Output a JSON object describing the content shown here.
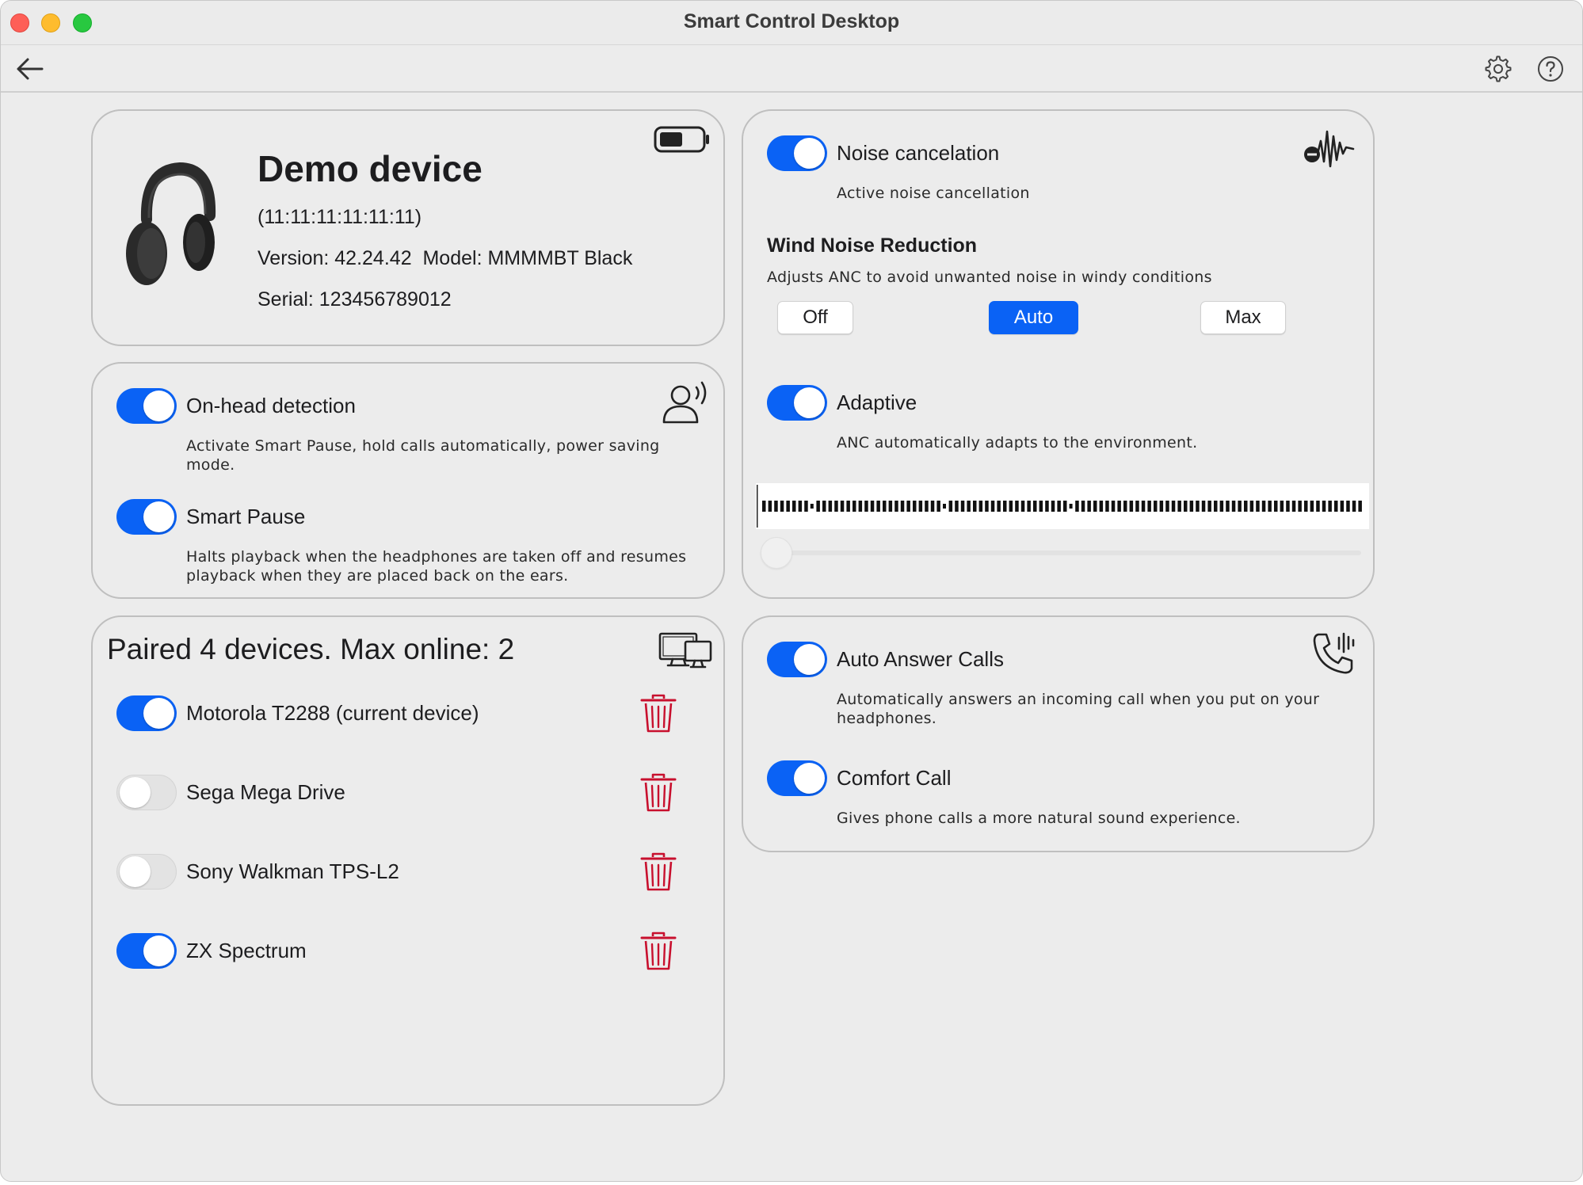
{
  "window": {
    "title": "Smart Control Desktop"
  },
  "toolbar": {
    "back_icon": "arrow-left-icon",
    "settings_icon": "gear-icon",
    "help_icon": "question-circle-icon"
  },
  "device": {
    "name": "Demo device",
    "address": "(11:11:11:11:11:11)",
    "version_model": "Version: 42.24.42  Model: MMMMBT Black",
    "serial": "Serial: 123456789012",
    "battery_icon": "battery-half-icon",
    "image_icon": "headphones-image"
  },
  "detection": {
    "icon": "person-voice-icon",
    "on_head": {
      "label": "On-head detection",
      "desc": "Activate Smart Pause, hold calls automatically, power saving mode.",
      "enabled": true
    },
    "smart_pause": {
      "label": "Smart Pause",
      "desc": "Halts playback when the headphones are taken off and resumes playback when they are placed back on the ears.",
      "enabled": true
    }
  },
  "anc": {
    "icon": "noise-wave-icon",
    "noise_cancelation": {
      "label": "Noise cancelation",
      "desc": "Active noise cancellation",
      "enabled": true
    },
    "wind": {
      "title": "Wind Noise Reduction",
      "desc": "Adjusts ANC to avoid unwanted noise in windy conditions",
      "options": [
        "Off",
        "Auto",
        "Max"
      ],
      "selected": "Auto"
    },
    "adaptive": {
      "label": "Adaptive",
      "desc": "ANC automatically adapts to the environment.",
      "enabled": true
    },
    "slider_value": 0
  },
  "paired": {
    "title": "Paired 4 devices. Max online: 2",
    "icon": "devices-icon",
    "devices": [
      {
        "name": "Motorola T2288 (current device)",
        "enabled": true
      },
      {
        "name": "Sega Mega Drive",
        "enabled": false
      },
      {
        "name": "Sony Walkman TPS-L2",
        "enabled": false
      },
      {
        "name": "ZX Spectrum",
        "enabled": true
      }
    ],
    "delete_icon": "trash-icon",
    "delete_color": "#c8102e"
  },
  "calls": {
    "icon": "phone-vibrate-icon",
    "auto_answer": {
      "label": "Auto Answer Calls",
      "desc": "Automatically answers an incoming call when you put on your headphones.",
      "enabled": true
    },
    "comfort_call": {
      "label": "Comfort Call",
      "desc": "Gives phone calls a more natural sound experience.",
      "enabled": true
    }
  },
  "colors": {
    "accent": "#0a62f5",
    "toggle_off": "#e3e3e3",
    "danger": "#c8102e"
  }
}
